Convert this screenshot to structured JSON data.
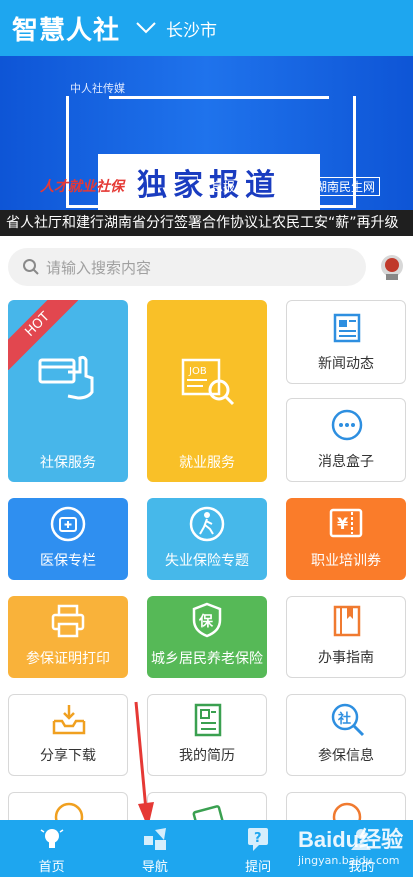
{
  "header": {
    "app_title": "智慧人社",
    "city": "长沙市",
    "city_icon": "chevron-down-icon"
  },
  "banner": {
    "brand": "中人社传媒",
    "headline": "独家报道",
    "logos": [
      "人才就业社保",
      "信息报",
      "湖南民生网"
    ],
    "slide_count": 5,
    "active_slide": 0
  },
  "ticker": "省人社厅和建行湖南省分行签署合作协议让农民工安“薪”再升级",
  "search": {
    "placeholder": "请输入搜索内容",
    "icon": "search-icon"
  },
  "tiles": {
    "social_security": {
      "label": "社保服务",
      "hot": "HOT",
      "color": "#47b6ea"
    },
    "employment": {
      "label": "就业服务",
      "color": "#f9c028"
    },
    "news": {
      "label": "新闻动态"
    },
    "messages": {
      "label": "消息盒子"
    },
    "medical": {
      "label": "医保专栏",
      "color": "#2f8ff0"
    },
    "unemployment": {
      "label": "失业保险专题",
      "color": "#46b8ea"
    },
    "training": {
      "label": "职业培训券",
      "color": "#fa7c2a"
    },
    "print": {
      "label": "参保证明打印",
      "color": "#f9b23a"
    },
    "pension": {
      "label": "城乡居民养老保险",
      "color": "#56b957"
    },
    "guide": {
      "label": "办事指南"
    },
    "download": {
      "label": "分享下载"
    },
    "resume": {
      "label": "我的简历"
    },
    "insured_info": {
      "label": "参保信息"
    }
  },
  "nav": [
    {
      "label": "首页",
      "icon": "lightbulb-icon"
    },
    {
      "label": "导航",
      "icon": "send-icon"
    },
    {
      "label": "提问",
      "icon": "question-icon"
    },
    {
      "label": "我的",
      "icon": "person-icon"
    }
  ],
  "watermark": {
    "brand": "Baidu经验",
    "url": "jingyan.baidu.com"
  },
  "colors": {
    "primary": "#1ea6ef",
    "annotation_arrow": "#e53935"
  }
}
